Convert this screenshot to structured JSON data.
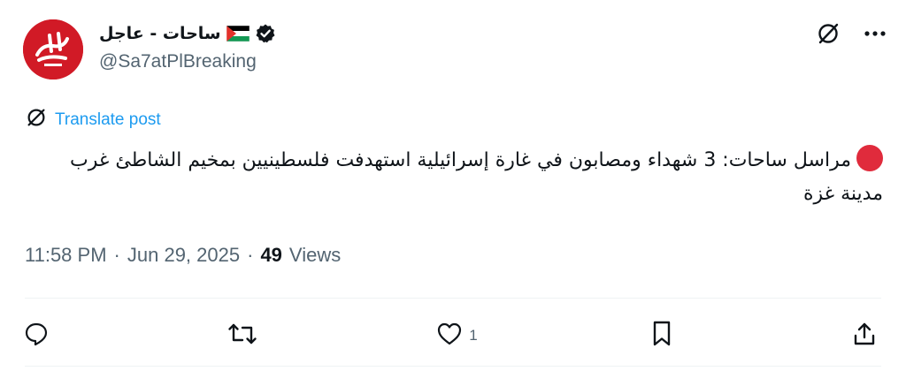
{
  "author": {
    "display_name": "ساحات - عاجل",
    "handle": "@Sa7atPlBreaking",
    "avatar_icon": "sahat-logo",
    "flag_icon": "palestine-flag-icon",
    "verified_icon": "verified-badge-icon"
  },
  "translate": {
    "label": "Translate post",
    "icon": "translate-icon"
  },
  "post": {
    "text_line": "مراسل ساحات: 3 شهداء ومصابون في غارة إسرائيلية استهدفت فلسطينيين بمخيم الشاطئ غرب مدينة غزة",
    "leading_emoji": "red-circle"
  },
  "meta": {
    "time": "11:58 PM",
    "separator": "·",
    "date": "Jun 29, 2025",
    "views_count": "49",
    "views_label": "Views"
  },
  "actions": {
    "reply_count": "",
    "repost_count": "",
    "like_count": "1",
    "bookmark_count": "",
    "share_count": ""
  },
  "colors": {
    "accent": "#1d9bf0",
    "secondary_text": "#536471",
    "primary_text": "#0f1419",
    "brand_red": "#d11a26"
  }
}
